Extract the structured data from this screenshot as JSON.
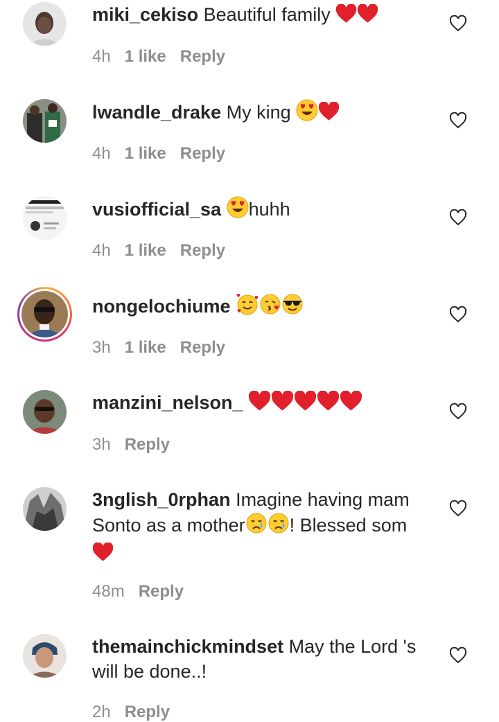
{
  "comments": [
    {
      "username": "miki_cekiso",
      "text": "Beautiful family",
      "time": "4h",
      "likes": "1 like",
      "reply": "Reply"
    },
    {
      "username": "lwandle_drake",
      "text": "My king",
      "time": "4h",
      "likes": "1 like",
      "reply": "Reply"
    },
    {
      "username": "vusiofficial_sa",
      "text": "huhh",
      "time": "4h",
      "likes": "1 like",
      "reply": "Reply"
    },
    {
      "username": "nongelochiume",
      "text": "",
      "time": "3h",
      "likes": "1 like",
      "reply": "Reply"
    },
    {
      "username": "manzini_nelson_",
      "text": "",
      "time": "3h",
      "likes": "",
      "reply": "Reply"
    },
    {
      "username": "3nglish_0rphan",
      "text_a": "Imagine having mam Sonto as a mother",
      "text_b": "! Blessed som",
      "time": "48m",
      "reply": "Reply"
    },
    {
      "username": "themainchickmindset",
      "text": "May the Lord 's will be done..!",
      "time": "2h",
      "reply": "Reply"
    }
  ],
  "icons": {
    "heart_outline": "heart-outline-icon",
    "red_heart": "red-heart-emoji",
    "heart_eyes": "heart-eyes-emoji",
    "smiling_hearts": "smiling-face-with-hearts-emoji",
    "kiss": "face-blowing-kiss-emoji",
    "sunglasses": "sunglasses-face-emoji",
    "crying": "crying-face-emoji"
  },
  "colors": {
    "text": "#262626",
    "meta": "#8e8e8e",
    "heart": "#e0202b",
    "emoji_yellow": "#ffcc33"
  }
}
